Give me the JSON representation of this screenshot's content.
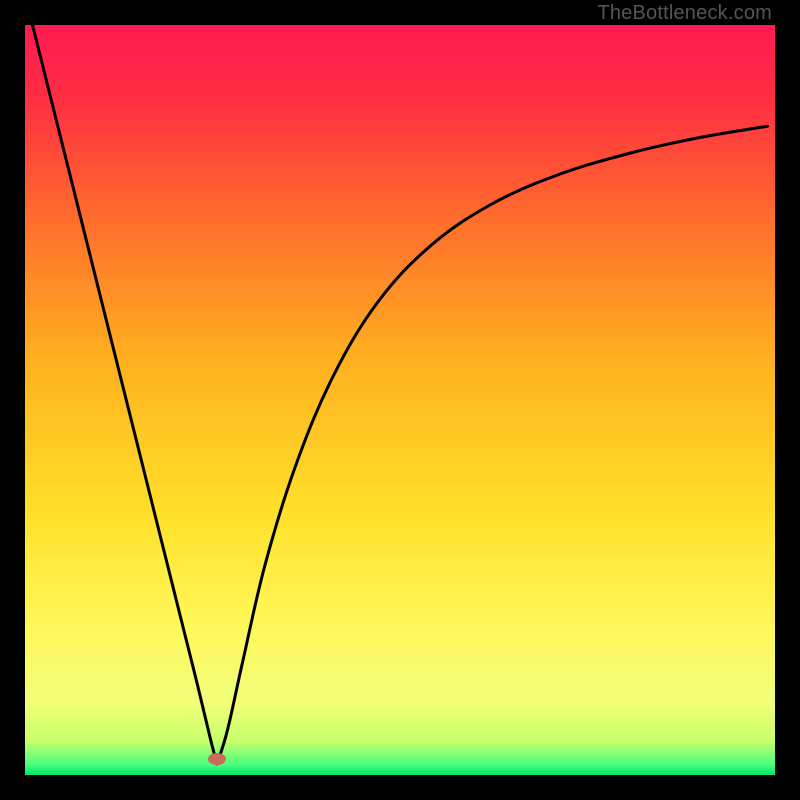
{
  "watermark": "TheBottleneck.com",
  "gradient": {
    "stops": [
      {
        "offset": 0.0,
        "color": "#ff1a52"
      },
      {
        "offset": 0.1,
        "color": "#ff2f42"
      },
      {
        "offset": 0.25,
        "color": "#ff6a2e"
      },
      {
        "offset": 0.45,
        "color": "#ffb21f"
      },
      {
        "offset": 0.65,
        "color": "#ffe02a"
      },
      {
        "offset": 0.8,
        "color": "#fff85a"
      },
      {
        "offset": 0.9,
        "color": "#f3ff7a"
      },
      {
        "offset": 0.955,
        "color": "#c8ff6a"
      },
      {
        "offset": 0.985,
        "color": "#4dff7f"
      },
      {
        "offset": 1.0,
        "color": "#00e86b"
      }
    ]
  },
  "marker": {
    "x_frac": 0.256,
    "y_frac": 0.978,
    "w": 18,
    "h": 12,
    "color": "#cc6a5c"
  },
  "chart_data": {
    "type": "line",
    "title": "",
    "xlabel": "",
    "ylabel": "",
    "xlim": [
      0,
      1
    ],
    "ylim": [
      0,
      1
    ],
    "grid": false,
    "legend": false,
    "series": [
      {
        "name": "left-branch",
        "x": [
          0.01,
          0.03,
          0.06,
          0.09,
          0.12,
          0.15,
          0.18,
          0.21,
          0.23,
          0.248,
          0.256
        ],
        "y": [
          1.0,
          0.92,
          0.8,
          0.68,
          0.56,
          0.44,
          0.32,
          0.2,
          0.12,
          0.045,
          0.015
        ]
      },
      {
        "name": "right-branch",
        "x": [
          0.256,
          0.27,
          0.29,
          0.32,
          0.36,
          0.41,
          0.47,
          0.54,
          0.62,
          0.71,
          0.81,
          0.9,
          0.99
        ],
        "y": [
          0.015,
          0.06,
          0.15,
          0.28,
          0.41,
          0.53,
          0.63,
          0.705,
          0.76,
          0.8,
          0.83,
          0.85,
          0.865
        ]
      }
    ],
    "annotations": [
      {
        "text": "TheBottleneck.com",
        "position": "top-right"
      }
    ]
  }
}
